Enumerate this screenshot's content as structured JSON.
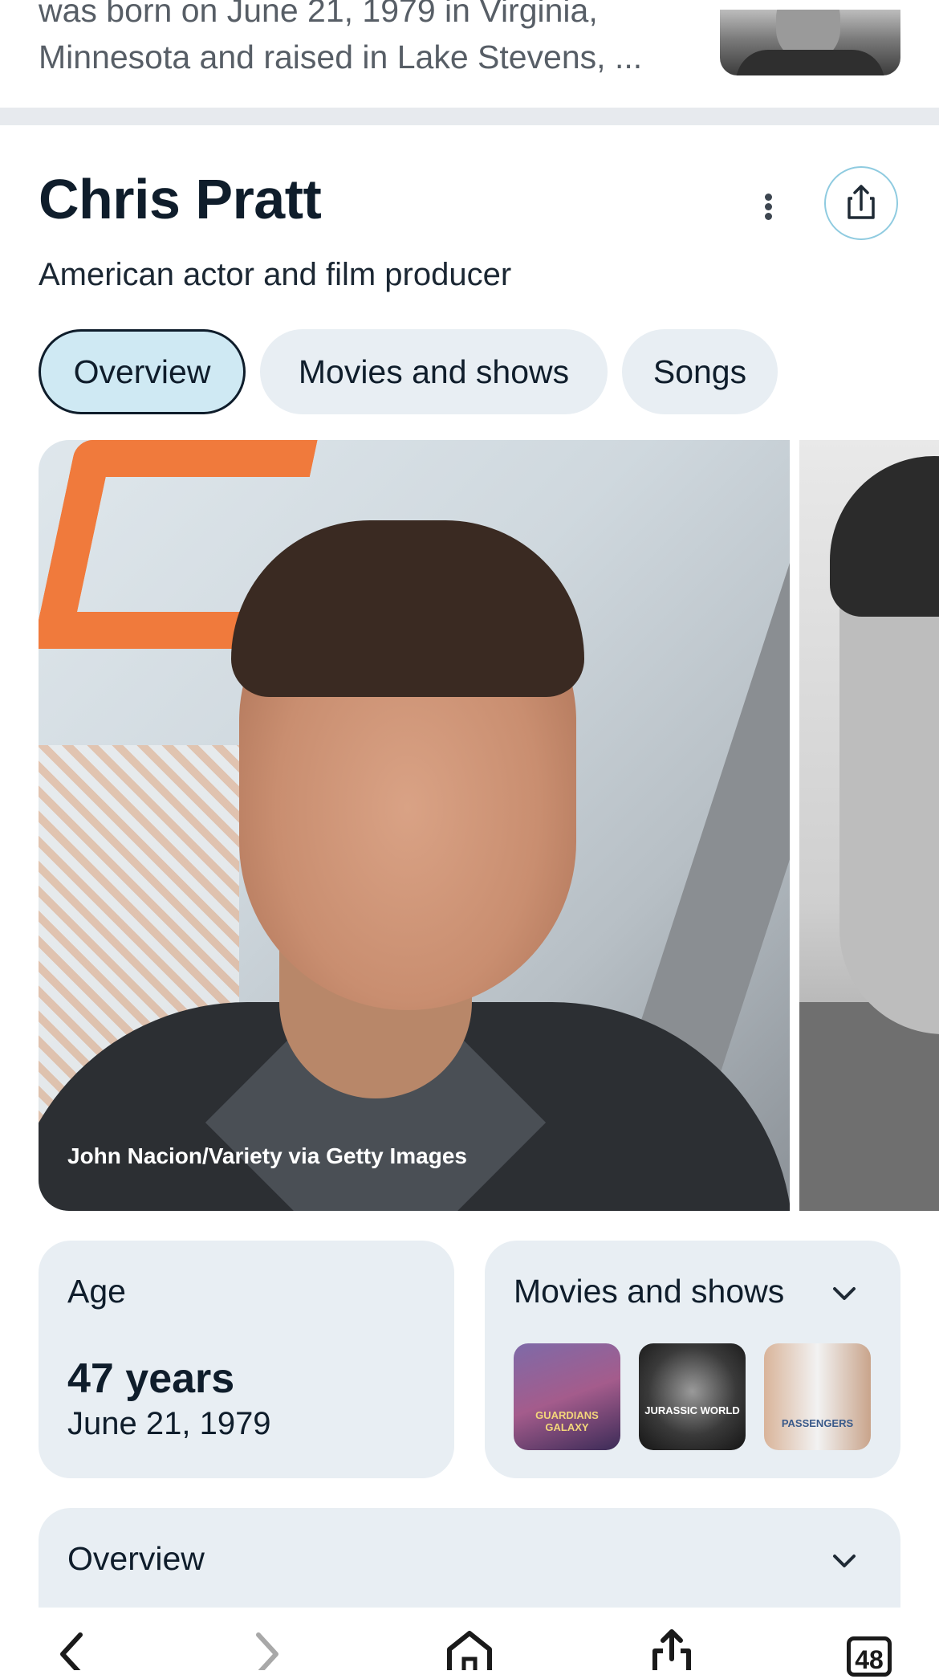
{
  "snippet": {
    "line1": "was born on June 21, 1979 in Virginia,",
    "line2": "Minnesota and raised in Lake Stevens, ..."
  },
  "header": {
    "title": "Chris Pratt",
    "subtitle": "American actor and film producer"
  },
  "tabs": [
    {
      "label": "Overview",
      "active": true
    },
    {
      "label": "Movies and shows",
      "active": false
    },
    {
      "label": "Songs",
      "active": false
    }
  ],
  "hero": {
    "caption": "John Nacion/Variety via Getty Images"
  },
  "age_card": {
    "label": "Age",
    "value": "47 years",
    "date": "June 21, 1979"
  },
  "movies_card": {
    "label": "Movies and shows",
    "posters": [
      "GUARDIANS GALAXY",
      "JURASSIC WORLD",
      "PASSENGERS"
    ]
  },
  "overview_card": {
    "label": "Overview"
  },
  "bottom_nav": {
    "tab_count": "48"
  },
  "colors": {
    "chip_bg": "#e8eef3",
    "chip_active_bg": "#cfe9f3",
    "card_bg": "#e8eef3",
    "share_ring": "#8fcbe0"
  }
}
